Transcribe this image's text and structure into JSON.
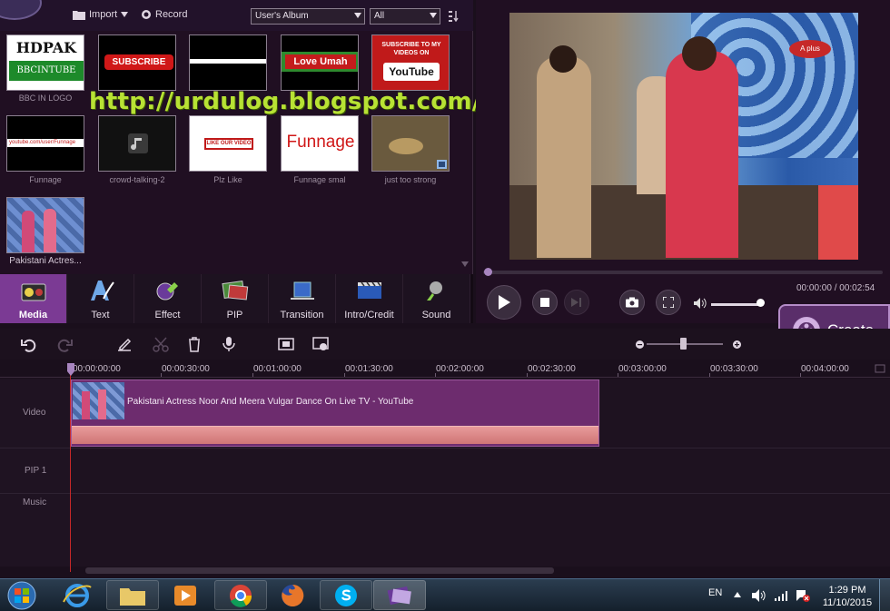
{
  "toolbar": {
    "import_label": "Import",
    "record_label": "Record",
    "album_select": "User's Album",
    "filter_select": "All"
  },
  "library": {
    "items": [
      {
        "caption": "BBC IN LOGO",
        "thumb_text_1": "HDPAK",
        "thumb_text_2": "BBCINTUBE"
      },
      {
        "caption": "",
        "thumb_text_1": "SUBSCRIBE"
      },
      {
        "caption": "",
        "thumb_text_1": ""
      },
      {
        "caption": "",
        "thumb_text_1": "Love Umah"
      },
      {
        "caption": "",
        "thumb_text_1": "SUBSCRIBE TO MY VIDEOS ON",
        "thumb_text_2": "YouTube"
      },
      {
        "caption": "Funnage",
        "thumb_text_1": "youtube.com/user/Funnage"
      },
      {
        "caption": "crowd-talking-2",
        "thumb_text_1": ""
      },
      {
        "caption": "Plz Like",
        "thumb_text_1": "LIKE OUR VIDEO"
      },
      {
        "caption": "Funnage smal",
        "thumb_text_1": "Funnage"
      },
      {
        "caption": "just too strong",
        "thumb_text_1": ""
      },
      {
        "caption": "Pakistani Actres...",
        "thumb_text_1": ""
      }
    ],
    "watermark": "http://urdulog.blogspot.com/"
  },
  "tabs": [
    {
      "label": "Media",
      "icon": "media-icon"
    },
    {
      "label": "Text",
      "icon": "text-icon"
    },
    {
      "label": "Effect",
      "icon": "effect-icon"
    },
    {
      "label": "PIP",
      "icon": "pip-icon"
    },
    {
      "label": "Transition",
      "icon": "transition-icon"
    },
    {
      "label": "Intro/Credit",
      "icon": "intro-credit-icon"
    },
    {
      "label": "Sound",
      "icon": "sound-icon"
    }
  ],
  "preview": {
    "time_readout": "00:00:00 / 00:02:54",
    "channel_logo": "A plus",
    "volume_level": 0.85
  },
  "create_button": {
    "label": "Create"
  },
  "timeline": {
    "ruler": [
      "00:00:00:00",
      "00:00:30:00",
      "00:01:00:00",
      "00:01:30:00",
      "00:02:00:00",
      "00:02:30:00",
      "00:03:00:00",
      "00:03:30:00",
      "00:04:00:00"
    ],
    "tracks": [
      {
        "label": "Video"
      },
      {
        "label": "PIP 1"
      },
      {
        "label": "Music"
      }
    ],
    "clip_title": "Pakistani Actress Noor And Meera Vulgar Dance On Live TV - YouTube"
  },
  "taskbar": {
    "language": "EN",
    "time": "1:29 PM",
    "date": "11/10/2015"
  },
  "colors": {
    "accent": "#7b3a94",
    "background": "#1a0f1c",
    "watermark": "#b8e234",
    "playhead": "#c62828"
  }
}
